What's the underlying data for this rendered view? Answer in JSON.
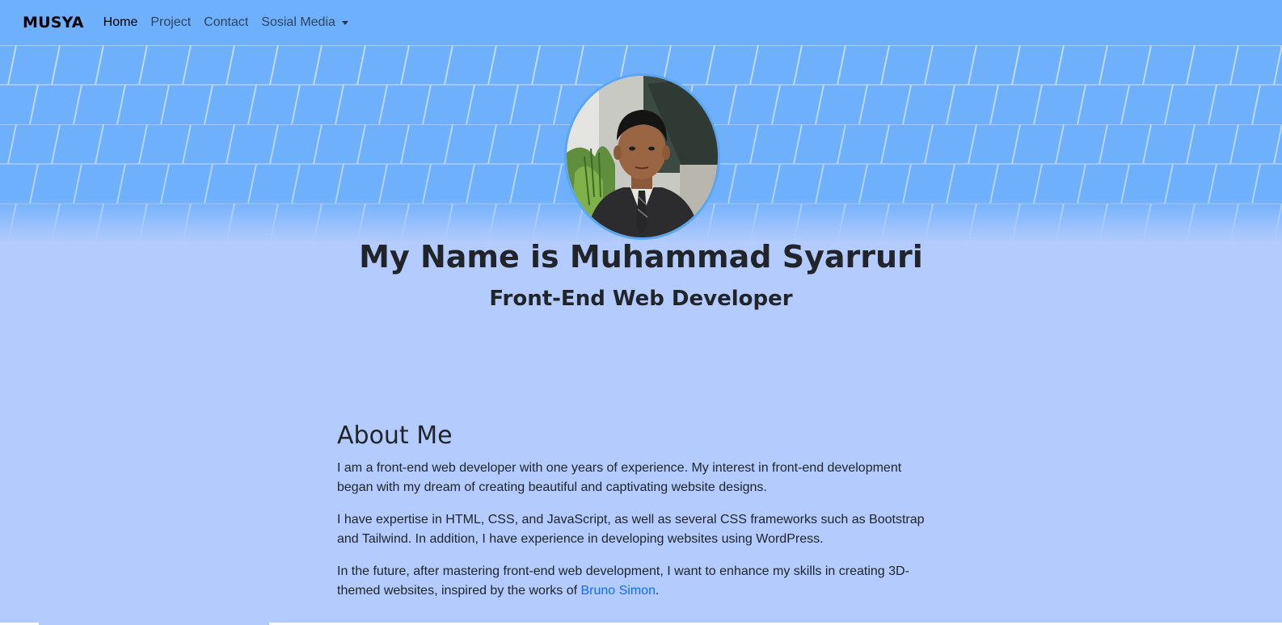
{
  "navbar": {
    "brand": "MUSYA",
    "links": [
      {
        "label": "Home",
        "active": true
      },
      {
        "label": "Project",
        "active": false
      },
      {
        "label": "Contact",
        "active": false
      },
      {
        "label": "Sosial Media",
        "active": false,
        "dropdown": true
      }
    ]
  },
  "hero": {
    "title": "My Name is Muhammad Syarruri",
    "subtitle": "Front-End Web Developer",
    "avatar_icon": "profile-photo"
  },
  "about": {
    "heading": "About Me",
    "p1": "I am a front-end web developer with one years of experience. My interest in front-end development began with my dream of creating beautiful and captivating website designs.",
    "p2": "I have expertise in HTML, CSS, and JavaScript, as well as several CSS frameworks such as Bootstrap and Tailwind. In addition, I have experience in developing websites using WordPress.",
    "p3_before": "In the future, after mastering front-end web development, I want to enhance my skills in creating 3D-themed websites, inspired by the works of ",
    "p3_link": "Bruno Simon",
    "p3_after": "."
  },
  "colors": {
    "navbar": "#6fb0fd",
    "page_bg": "#b3cbfd",
    "link": "#0d6efd",
    "avatar_border": "#5aa6f3"
  }
}
